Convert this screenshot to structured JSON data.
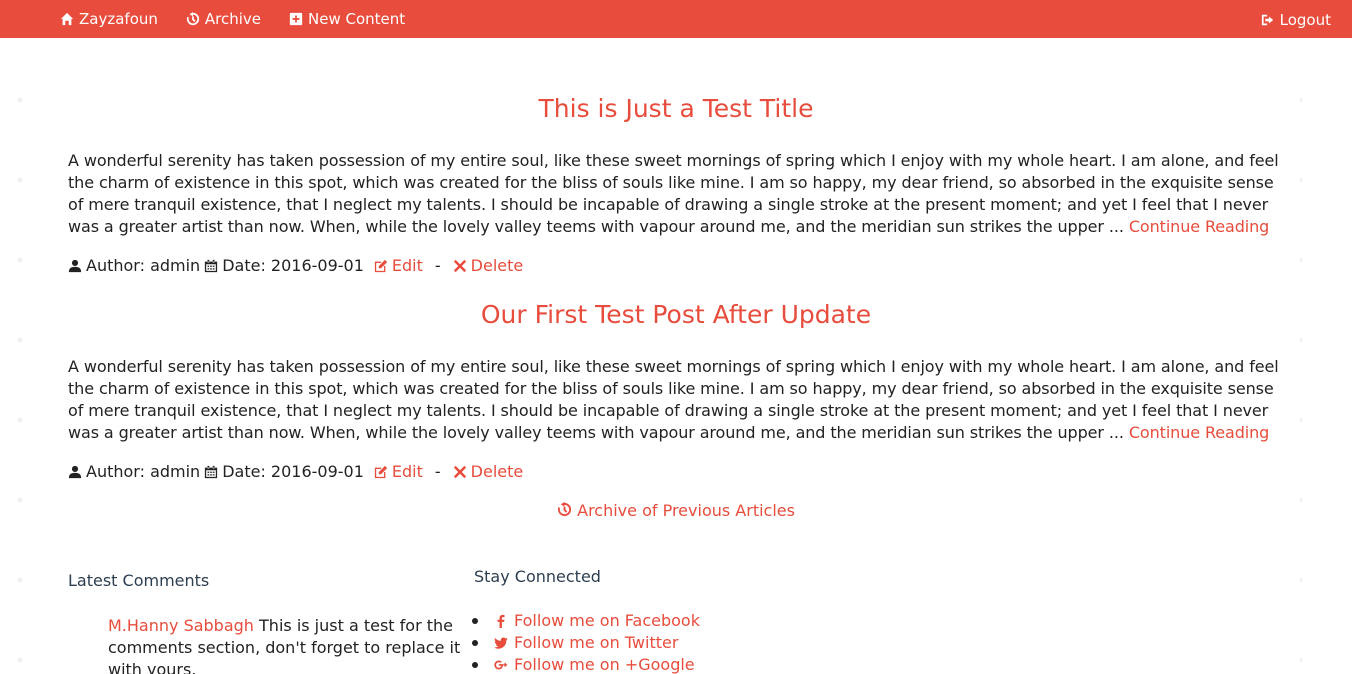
{
  "nav": {
    "home_label": "Zayzafoun",
    "archive_label": "Archive",
    "new_content_label": "New Content",
    "logout_label": "Logout"
  },
  "posts": [
    {
      "title": "This is Just a Test Title",
      "excerpt": "A wonderful serenity has taken possession of my entire soul, like these sweet mornings of spring which I enjoy with my whole heart. I am alone, and feel the charm of existence in this spot, which was created for the bliss of souls like mine. I am so happy, my dear friend, so absorbed in the exquisite sense of mere tranquil existence, that I neglect my talents. I should be incapable of drawing a single stroke at the present moment; and yet I feel that I never was a greater artist than now. When, while the lovely valley teems with vapour around me, and the meridian sun strikes the upper ...",
      "continue_label": "Continue Reading",
      "author_text": "Author: admin",
      "date_text": "Date: 2016-09-01",
      "edit_label": "Edit",
      "separator": "-",
      "delete_label": "Delete"
    },
    {
      "title": "Our First Test Post After Update",
      "excerpt": "A wonderful serenity has taken possession of my entire soul, like these sweet mornings of spring which I enjoy with my whole heart. I am alone, and feel the charm of existence in this spot, which was created for the bliss of souls like mine. I am so happy, my dear friend, so absorbed in the exquisite sense of mere tranquil existence, that I neglect my talents. I should be incapable of drawing a single stroke at the present moment; and yet I feel that I never was a greater artist than now. When, while the lovely valley teems with vapour around me, and the meridian sun strikes the upper ...",
      "continue_label": "Continue Reading",
      "author_text": "Author: admin",
      "date_text": "Date: 2016-09-01",
      "edit_label": "Edit",
      "separator": "-",
      "delete_label": "Delete"
    }
  ],
  "archive_link_label": "Archive of Previous Articles",
  "latest_comments": {
    "title": "Latest Comments",
    "items": [
      {
        "author": "M.Hanny Sabbagh",
        "text": "This is just a test for the comments section, don't forget to replace it with yours."
      }
    ]
  },
  "stay_connected": {
    "title": "Stay Connected",
    "facebook_label": "Follow me on Facebook",
    "twitter_label": "Follow me on Twitter",
    "google_label": "Follow me on +Google"
  },
  "colors": {
    "accent": "#e74c3c",
    "text": "#222222",
    "heading": "#2c3e50"
  }
}
